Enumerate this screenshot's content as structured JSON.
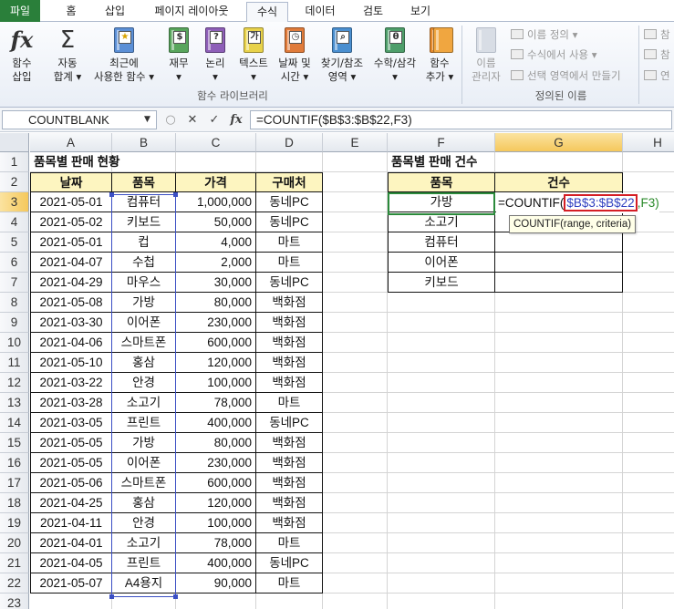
{
  "colors": {
    "file_tab": "#2a7f3a",
    "header_fill": "#fdf5c0",
    "range_ref": "#3040c0",
    "range_box_border": "#d51e25",
    "arg2": "#2a8a2a",
    "active_cell": "#2b8a3b"
  },
  "tabs": [
    "파일",
    "홈",
    "삽입",
    "페이지 레이아웃",
    "수식",
    "데이터",
    "검토",
    "보기"
  ],
  "active_tab": "수식",
  "ribbon": {
    "fx": {
      "label1": "함수",
      "label2": "삽입",
      "icon": "function-icon"
    },
    "autosum": {
      "label1": "자동",
      "label2": "합계 ▾",
      "icon": "sigma-icon"
    },
    "recent": {
      "label1": "최근에",
      "label2": "사용한 함수 ▾",
      "icon": "book-star-icon"
    },
    "financial": {
      "label1": "재무",
      "label2": "▾",
      "icon": "book-financial-icon"
    },
    "logical": {
      "label1": "논리",
      "label2": "▾",
      "icon": "book-logical-icon"
    },
    "text": {
      "label1": "텍스트",
      "label2": "▾",
      "icon": "book-text-icon"
    },
    "datetime": {
      "label1": "날짜 및",
      "label2": "시간 ▾",
      "icon": "book-datetime-icon"
    },
    "lookup": {
      "label1": "찾기/참조",
      "label2": "영역 ▾",
      "icon": "book-lookup-icon"
    },
    "math": {
      "label1": "수학/삼각",
      "label2": "▾",
      "icon": "book-math-icon"
    },
    "more": {
      "label1": "함수",
      "label2": "추가 ▾",
      "icon": "book-more-icon"
    },
    "group_library": "함수 라이브러리",
    "name_manager": {
      "label1": "이름",
      "label2": "관리자",
      "icon": "name-manager-icon"
    },
    "define_name": "이름 정의 ▾",
    "use_in_formula": "수식에서 사용 ▾",
    "create_from_selection": "선택 영역에서 만들기",
    "group_names": "정의된 이름",
    "trace1": "참",
    "trace2": "참",
    "trace3": "연"
  },
  "formula_bar": {
    "name_box": "COUNTBLANK",
    "cancel": "✕",
    "enter": "✓",
    "fx": "fx",
    "formula": "=COUNTIF($B$3:$B$22,F3)"
  },
  "columns": [
    "A",
    "B",
    "C",
    "D",
    "E",
    "F",
    "G",
    "H"
  ],
  "rows": [
    "1",
    "2",
    "3",
    "4",
    "5",
    "6",
    "7",
    "8",
    "9",
    "10",
    "11",
    "12",
    "13",
    "14",
    "15",
    "16",
    "17",
    "18",
    "19",
    "20",
    "21",
    "22",
    "23"
  ],
  "sheet": {
    "title_left": "품목별 판매 현황",
    "title_right": "품목별 판매 건수",
    "headers_left": [
      "날짜",
      "품목",
      "가격",
      "구매처"
    ],
    "headers_right": [
      "품목",
      "건수"
    ],
    "sales": [
      [
        "2021-05-01",
        "컴퓨터",
        "1,000,000",
        "동네PC"
      ],
      [
        "2021-05-02",
        "키보드",
        "50,000",
        "동네PC"
      ],
      [
        "2021-05-01",
        "컵",
        "4,000",
        "마트"
      ],
      [
        "2021-04-07",
        "수첩",
        "2,000",
        "마트"
      ],
      [
        "2021-04-29",
        "마우스",
        "30,000",
        "동네PC"
      ],
      [
        "2021-05-08",
        "가방",
        "80,000",
        "백화점"
      ],
      [
        "2021-03-30",
        "이어폰",
        "230,000",
        "백화점"
      ],
      [
        "2021-04-06",
        "스마트폰",
        "600,000",
        "백화점"
      ],
      [
        "2021-05-10",
        "홍삼",
        "120,000",
        "백화점"
      ],
      [
        "2021-03-22",
        "안경",
        "100,000",
        "백화점"
      ],
      [
        "2021-03-28",
        "소고기",
        "78,000",
        "마트"
      ],
      [
        "2021-03-05",
        "프린트",
        "400,000",
        "동네PC"
      ],
      [
        "2021-05-05",
        "가방",
        "80,000",
        "백화점"
      ],
      [
        "2021-05-05",
        "이어폰",
        "230,000",
        "백화점"
      ],
      [
        "2021-05-06",
        "스마트폰",
        "600,000",
        "백화점"
      ],
      [
        "2021-04-25",
        "홍삼",
        "120,000",
        "백화점"
      ],
      [
        "2021-04-11",
        "안경",
        "100,000",
        "백화점"
      ],
      [
        "2021-04-01",
        "소고기",
        "78,000",
        "마트"
      ],
      [
        "2021-04-05",
        "프린트",
        "400,000",
        "동네PC"
      ],
      [
        "2021-05-07",
        "A4용지",
        "90,000",
        "마트"
      ]
    ],
    "items": [
      "가방",
      "소고기",
      "컴퓨터",
      "이어폰",
      "키보드"
    ]
  },
  "editing": {
    "prefix": "=COUNTIF(",
    "range": "$B$3:$B$22",
    "suffix": ",F3)",
    "tooltip": "COUNTIF(range, criteria)"
  }
}
